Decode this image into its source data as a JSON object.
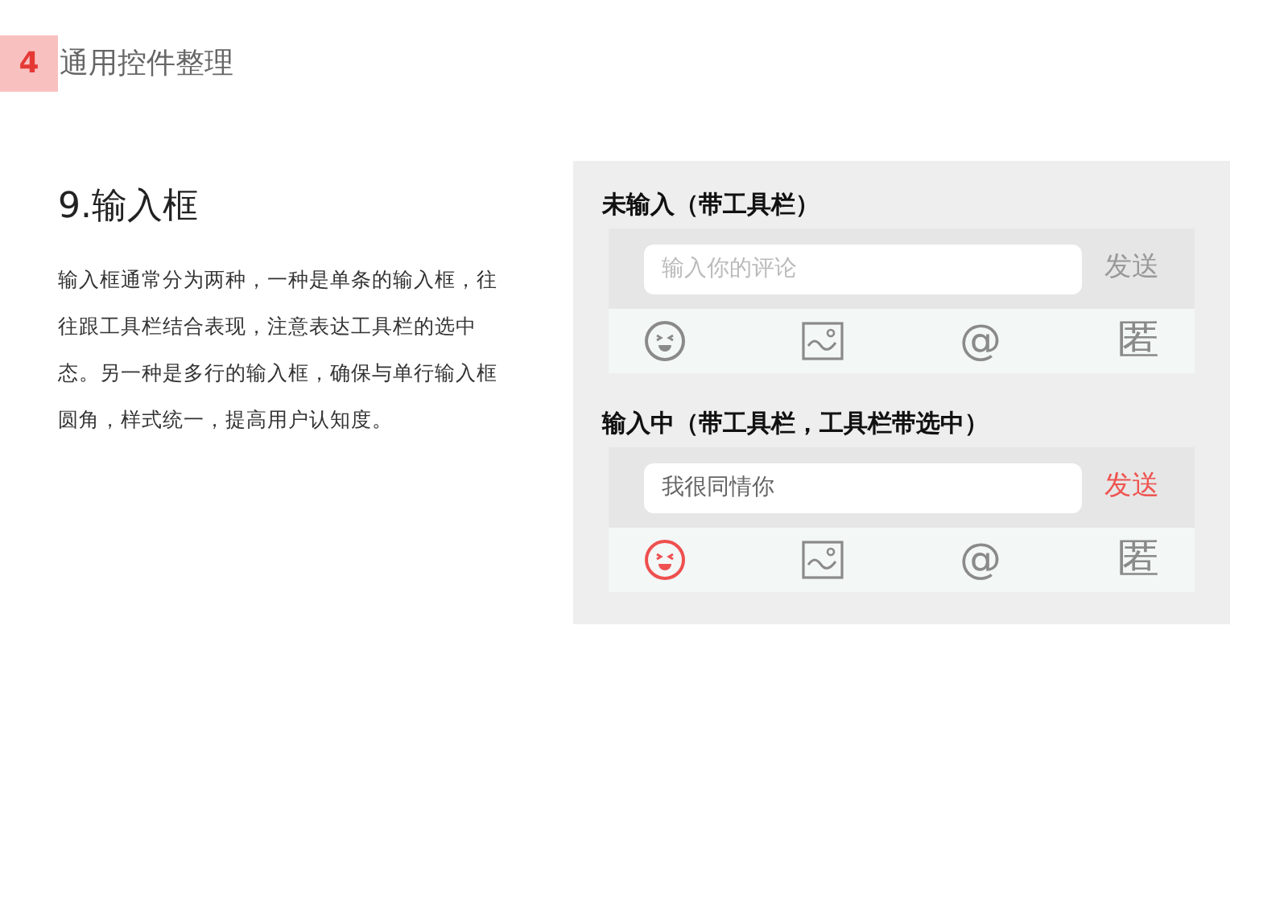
{
  "header": {
    "number": "4",
    "title": "通用控件整理"
  },
  "section": {
    "heading": "9.输入框",
    "description": "输入框通常分为两种，一种是单条的输入框，往往跟工具栏结合表现，注意表达工具栏的选中态。另一种是多行的输入框，确保与单行输入框圆角，样式统一，提高用户认知度。"
  },
  "examples": [
    {
      "title": "未输入（带工具栏）",
      "placeholder": "输入你的评论",
      "send": {
        "label": "发送",
        "active": false
      },
      "tools": [
        {
          "kind": "emoji",
          "selected": false
        },
        {
          "kind": "image",
          "selected": false
        },
        {
          "kind": "glyph",
          "text": "@",
          "selected": false
        },
        {
          "kind": "glyph",
          "text": "匿",
          "selected": false
        }
      ]
    },
    {
      "title": "输入中（带工具栏，工具栏带选中）",
      "value": "我很同情你",
      "send": {
        "label": "发送",
        "active": true
      },
      "tools": [
        {
          "kind": "emoji",
          "selected": true
        },
        {
          "kind": "image",
          "selected": false
        },
        {
          "kind": "glyph",
          "text": "@",
          "selected": false
        },
        {
          "kind": "glyph",
          "text": "匿",
          "selected": false
        }
      ]
    }
  ]
}
